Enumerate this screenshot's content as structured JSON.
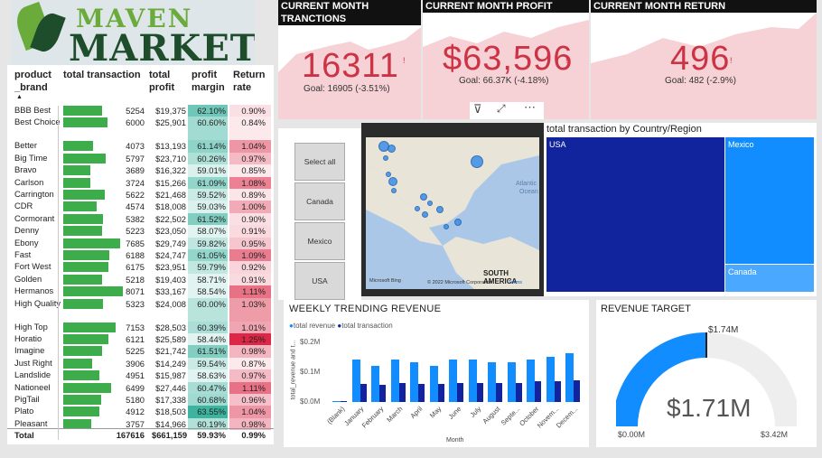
{
  "logo": {
    "word1": "MAVEN",
    "word2": "MARKET"
  },
  "table": {
    "headers": [
      "product _brand",
      "total transaction",
      "total profit",
      "profit margin",
      "Return rate"
    ],
    "rows": [
      {
        "brand": "BBB Best",
        "tx": "5254",
        "profit": "$19,375",
        "margin": "62.10%",
        "ret": "0.90%",
        "txv": 5254,
        "mv": 62.1,
        "rv": 0.9
      },
      {
        "brand": "Best Choice",
        "tx": "6000",
        "profit": "$25,901",
        "margin": "60.60%",
        "ret": "0.84%",
        "txv": 6000,
        "mv": 60.6,
        "rv": 0.84
      },
      {
        "brand": "Better",
        "tx": "4073",
        "profit": "$13,193",
        "margin": "61.14%",
        "ret": "1.04%",
        "txv": 4073,
        "mv": 61.14,
        "rv": 1.04
      },
      {
        "brand": "Big Time",
        "tx": "5797",
        "profit": "$23,710",
        "margin": "60.26%",
        "ret": "0.97%",
        "txv": 5797,
        "mv": 60.26,
        "rv": 0.97
      },
      {
        "brand": "Bravo",
        "tx": "3689",
        "profit": "$16,322",
        "margin": "59.01%",
        "ret": "0.85%",
        "txv": 3689,
        "mv": 59.01,
        "rv": 0.85
      },
      {
        "brand": "Carlson",
        "tx": "3724",
        "profit": "$15,266",
        "margin": "61.09%",
        "ret": "1.08%",
        "txv": 3724,
        "mv": 61.09,
        "rv": 1.08
      },
      {
        "brand": "Carrington",
        "tx": "5622",
        "profit": "$21,468",
        "margin": "59.52%",
        "ret": "0.89%",
        "txv": 5622,
        "mv": 59.52,
        "rv": 0.89
      },
      {
        "brand": "CDR",
        "tx": "4574",
        "profit": "$18,008",
        "margin": "59.03%",
        "ret": "1.00%",
        "txv": 4574,
        "mv": 59.03,
        "rv": 1.0
      },
      {
        "brand": "Cormorant",
        "tx": "5382",
        "profit": "$22,502",
        "margin": "61.52%",
        "ret": "0.90%",
        "txv": 5382,
        "mv": 61.52,
        "rv": 0.9
      },
      {
        "brand": "Denny",
        "tx": "5223",
        "profit": "$23,050",
        "margin": "58.07%",
        "ret": "0.91%",
        "txv": 5223,
        "mv": 58.07,
        "rv": 0.91
      },
      {
        "brand": "Ebony",
        "tx": "7685",
        "profit": "$29,749",
        "margin": "59.82%",
        "ret": "0.95%",
        "txv": 7685,
        "mv": 59.82,
        "rv": 0.95
      },
      {
        "brand": "Fast",
        "tx": "6188",
        "profit": "$24,747",
        "margin": "61.05%",
        "ret": "1.09%",
        "txv": 6188,
        "mv": 61.05,
        "rv": 1.09
      },
      {
        "brand": "Fort West",
        "tx": "6175",
        "profit": "$23,951",
        "margin": "59.79%",
        "ret": "0.92%",
        "txv": 6175,
        "mv": 59.79,
        "rv": 0.92
      },
      {
        "brand": "Golden",
        "tx": "5218",
        "profit": "$19,403",
        "margin": "58.71%",
        "ret": "0.91%",
        "txv": 5218,
        "mv": 58.71,
        "rv": 0.91
      },
      {
        "brand": "Hermanos",
        "tx": "8071",
        "profit": "$33,167",
        "margin": "58.54%",
        "ret": "1.11%",
        "txv": 8071,
        "mv": 58.54,
        "rv": 1.11
      },
      {
        "brand": "High Quality",
        "tx": "5323",
        "profit": "$24,008",
        "margin": "60.00%",
        "ret": "1.03%",
        "txv": 5323,
        "mv": 60.0,
        "rv": 1.03
      },
      {
        "brand": "High Top",
        "tx": "7153",
        "profit": "$28,503",
        "margin": "60.39%",
        "ret": "1.01%",
        "txv": 7153,
        "mv": 60.39,
        "rv": 1.01
      },
      {
        "brand": "Horatio",
        "tx": "6121",
        "profit": "$25,589",
        "margin": "58.44%",
        "ret": "1.25%",
        "txv": 6121,
        "mv": 58.44,
        "rv": 1.25
      },
      {
        "brand": "Imagine",
        "tx": "5225",
        "profit": "$21,742",
        "margin": "61.51%",
        "ret": "0.98%",
        "txv": 5225,
        "mv": 61.51,
        "rv": 0.98
      },
      {
        "brand": "Just Right",
        "tx": "3906",
        "profit": "$14,249",
        "margin": "59.54%",
        "ret": "0.87%",
        "txv": 3906,
        "mv": 59.54,
        "rv": 0.87
      },
      {
        "brand": "Landslide",
        "tx": "4951",
        "profit": "$15,987",
        "margin": "58.63%",
        "ret": "0.97%",
        "txv": 4951,
        "mv": 58.63,
        "rv": 0.97
      },
      {
        "brand": "Nationeel",
        "tx": "6499",
        "profit": "$27,446",
        "margin": "60.47%",
        "ret": "1.11%",
        "txv": 6499,
        "mv": 60.47,
        "rv": 1.11
      },
      {
        "brand": "PigTail",
        "tx": "5180",
        "profit": "$17,338",
        "margin": "60.68%",
        "ret": "0.96%",
        "txv": 5180,
        "mv": 60.68,
        "rv": 0.96
      },
      {
        "brand": "Plato",
        "tx": "4912",
        "profit": "$18,503",
        "margin": "63.55%",
        "ret": "1.04%",
        "txv": 4912,
        "mv": 63.55,
        "rv": 1.04
      },
      {
        "brand": "Pleasant",
        "tx": "3757",
        "profit": "$14,966",
        "margin": "60.19%",
        "ret": "0.98%",
        "txv": 3757,
        "mv": 60.19,
        "rv": 0.98
      }
    ],
    "total": {
      "brand": "Total",
      "tx": "167616",
      "profit": "$661,159",
      "margin": "59.93%",
      "ret": "0.99%"
    }
  },
  "kpis": [
    {
      "title": "CURRENT MONTH TRANCTIONS",
      "value": "16311",
      "goal": "Goal: 16905 (-3.51%)"
    },
    {
      "title": "CURRENT MONTH PROFIT",
      "value": "$63,596",
      "goal": "Goal: 66.37K (-4.18%)"
    },
    {
      "title": "CURRENT MONTH RETURN",
      "value": "496",
      "goal": "Goal: 482 (-2.9%)"
    }
  ],
  "slicer": [
    "Select all",
    "Canada",
    "Mexico",
    "USA"
  ],
  "map": {
    "ocean1": "Atlantic",
    "ocean2": "Ocean",
    "region": "SOUTH AMERICA",
    "brand": "Microsoft Bing",
    "copyright": "© 2022 Microsoft Corporation",
    "terms": "Terms"
  },
  "treemap": {
    "title": "total transaction by Country/Region",
    "usa": "USA",
    "mexico": "Mexico",
    "canada": "Canada"
  },
  "weekly": {
    "title": "WEEKLY TRENDING REVENUE",
    "legend1": "total revenue",
    "legend2": "total transaction",
    "ylabel": "total_revenue and t...",
    "xlabel": "Month",
    "yticks": [
      "$0.2M",
      "$0.1M",
      "$0.0M"
    ],
    "months": [
      "(Blank)",
      "January",
      "February",
      "March",
      "April",
      "May",
      "June",
      "July",
      "August",
      "Septe...",
      "October",
      "Novem...",
      "Decem..."
    ]
  },
  "chart_data": {
    "type": "bar",
    "title": "WEEKLY TRENDING REVENUE",
    "xlabel": "Month",
    "ylabel": "total_revenue and t...",
    "categories": [
      "(Blank)",
      "January",
      "February",
      "March",
      "April",
      "May",
      "June",
      "July",
      "August",
      "Septe...",
      "October",
      "Novem...",
      "Decem..."
    ],
    "ylim": [
      0,
      0.2
    ],
    "series": [
      {
        "name": "total revenue",
        "values": [
          0.002,
          0.14,
          0.12,
          0.14,
          0.13,
          0.12,
          0.14,
          0.14,
          0.13,
          0.13,
          0.14,
          0.15,
          0.16
        ]
      },
      {
        "name": "total transaction",
        "values": [
          0.0,
          0.015,
          0.014,
          0.016,
          0.015,
          0.015,
          0.016,
          0.016,
          0.016,
          0.016,
          0.017,
          0.017,
          0.018
        ]
      }
    ]
  },
  "target": {
    "title": "REVENUE TARGET",
    "value": "$1.71M",
    "target": "$1.74M",
    "min": "$0.00M",
    "max": "$3.42M",
    "fraction": 0.5
  }
}
